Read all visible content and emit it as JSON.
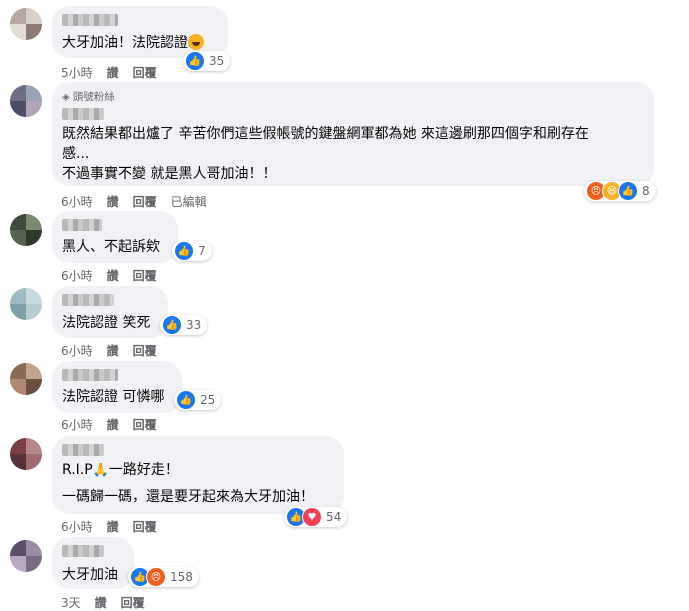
{
  "actions": {
    "like": "讚",
    "reply": "回覆",
    "edited": "已編輯"
  },
  "comments": [
    {
      "text": "大牙加油！法院認證",
      "emoji": "laughing-emoji",
      "time": "5小時",
      "reactions": [
        "like"
      ],
      "count": "35"
    },
    {
      "badge": "頭號粉絲",
      "lines": [
        "既然結果都出爐了 辛苦你們這些假帳號的鍵盤網軍都為她 來這邊刷那四個字和刷存在",
        "感...",
        "不過事實不變 就是黑人哥加油！！"
      ],
      "time": "6小時",
      "edited": true,
      "reactions": [
        "angry",
        "haha",
        "like"
      ],
      "count": "8"
    },
    {
      "text": "黑人、不起訴欸",
      "time": "6小時",
      "reactions": [
        "like"
      ],
      "count": "7"
    },
    {
      "text": "法院認證 笑死",
      "time": "6小時",
      "reactions": [
        "like"
      ],
      "count": "33"
    },
    {
      "text": "法院認證 可憐哪",
      "time": "6小時",
      "reactions": [
        "like"
      ],
      "count": "25"
    },
    {
      "line1_before": "R.I.P",
      "line1_emoji": "pray-emoji",
      "line1_after": "一路好走！",
      "line2": "一碼歸一碼，還是要牙起來為大牙加油！",
      "time": "6小時",
      "reactions": [
        "like",
        "love"
      ],
      "count": "54"
    },
    {
      "text": "大牙加油",
      "time": "3天",
      "reactions": [
        "like",
        "angry"
      ],
      "count": "158"
    }
  ]
}
